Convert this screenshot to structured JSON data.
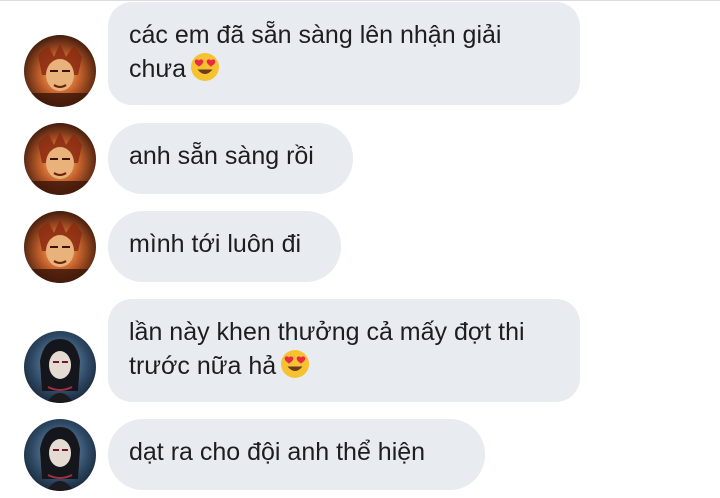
{
  "messages": [
    {
      "sender": "user-a",
      "text": "các em đã sẵn sàng lên nhận giải chưa",
      "emoji": "heart-eyes-emoji"
    },
    {
      "sender": "user-a",
      "text": "anh sẵn sàng rồi",
      "emoji": null
    },
    {
      "sender": "user-a",
      "text": "mình tới luôn đi",
      "emoji": null
    },
    {
      "sender": "user-b",
      "text": "lần này khen thưởng cả mấy đợt thi trước nữa hả",
      "emoji": "heart-eyes-emoji"
    },
    {
      "sender": "user-b",
      "text": "dạt ra cho đội anh thể hiện",
      "emoji": null
    }
  ],
  "colors": {
    "bubble": "#e8ebef",
    "text": "#1c1e21",
    "emoji_face": "#f7c230",
    "emoji_heart": "#ea2a45"
  }
}
